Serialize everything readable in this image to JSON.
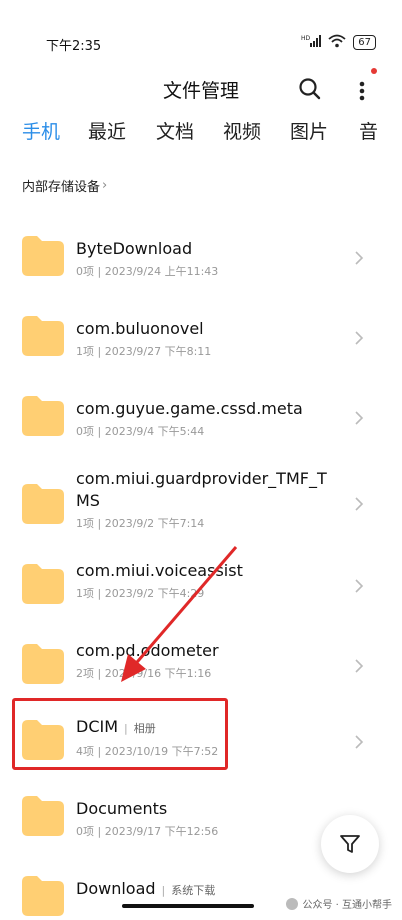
{
  "status_bar": {
    "time": "下午2:35",
    "battery": "67",
    "net_label": "HD"
  },
  "header": {
    "title": "文件管理"
  },
  "tabs": [
    {
      "label": "手机",
      "active": true
    },
    {
      "label": "最近"
    },
    {
      "label": "文档"
    },
    {
      "label": "视频"
    },
    {
      "label": "图片"
    },
    {
      "label": "音"
    }
  ],
  "breadcrumb": {
    "label": "内部存储设备"
  },
  "files": [
    {
      "name": "ByteDownload",
      "meta": "0项 | 2023/9/24 上午11:43"
    },
    {
      "name": "com.buluonovel",
      "meta": "1项 | 2023/9/27 下午8:11"
    },
    {
      "name": "com.guyue.game.cssd.meta",
      "meta": "0项 | 2023/9/4 下午5:44"
    },
    {
      "name_line1": "com.miui.guardprovider_TMF_T",
      "name_line2": "MS",
      "meta": "1项 | 2023/9/2 下午7:14"
    },
    {
      "name": "com.miui.voiceassist",
      "meta": "1项 | 2023/9/2 下午4:29"
    },
    {
      "name": "com.pd.odometer",
      "meta": "2项 | 2023/9/16 下午1:16"
    },
    {
      "name": "DCIM",
      "tag": "相册",
      "meta": "4项 | 2023/10/19 下午7:52"
    },
    {
      "name": "Documents",
      "meta": "0项 | 2023/9/17 下午12:56"
    },
    {
      "name": "Download",
      "tag": "系统下载"
    }
  ],
  "watermark": {
    "text": "公众号 · 互通小帮手"
  },
  "colors": {
    "accent": "#2b8ee8",
    "folder": "#ffcf73",
    "highlight": "#e02828"
  }
}
